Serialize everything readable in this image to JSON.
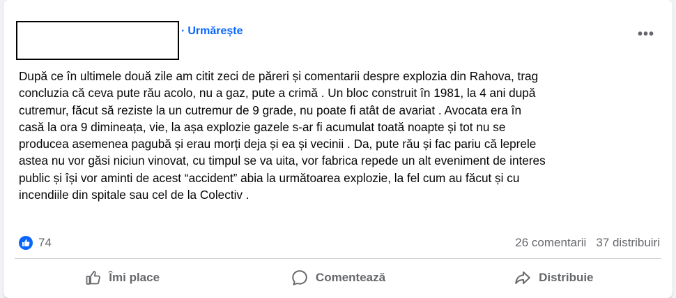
{
  "header": {
    "follow_separator": "·",
    "follow_label": "Urmărește",
    "more_label": "•••"
  },
  "post": {
    "text": "După ce în ultimele două zile am citit zeci de păreri și comentarii despre explozia din Rahova, trag\nconcluzia că ceva pute rău acolo, nu a gaz, pute a crimă . Un bloc construit în 1981, la 4 ani după\ncutremur, făcut să reziste la un cutremur de 9 grade, nu poate fi atât de avariat . Avocata era în\ncasă la ora 9 dimineața, vie, la așa explozie gazele s-ar fi acumulat toată noapte și tot nu se\nproducea asemenea pagubă și erau morți deja și ea și vecinii . Da, pute rău și fac pariu că leprele\nastea nu vor găsi niciun vinovat, cu timpul se va uita, vor fabrica repede un alt eveniment de interes\npublic și își vor aminti de acest “accident” abia la următoarea explozie, la fel cum au făcut și cu\nincendiile din spitale sau cel de la Colectiv ."
  },
  "stats": {
    "reaction_count": "74",
    "comments": "26 comentarii",
    "shares": "37 distribuiri"
  },
  "actions": {
    "like": "Îmi place",
    "comment": "Comentează",
    "share": "Distribuie"
  },
  "colors": {
    "accent": "#0866ff",
    "secondary_text": "#65676b",
    "primary_text": "#050505"
  },
  "icons": {
    "like_badge": "thumbs-up-icon",
    "like_action": "thumbs-up-outline-icon",
    "comment_action": "speech-bubble-icon",
    "share_action": "share-arrow-icon",
    "more": "more-options-icon"
  }
}
